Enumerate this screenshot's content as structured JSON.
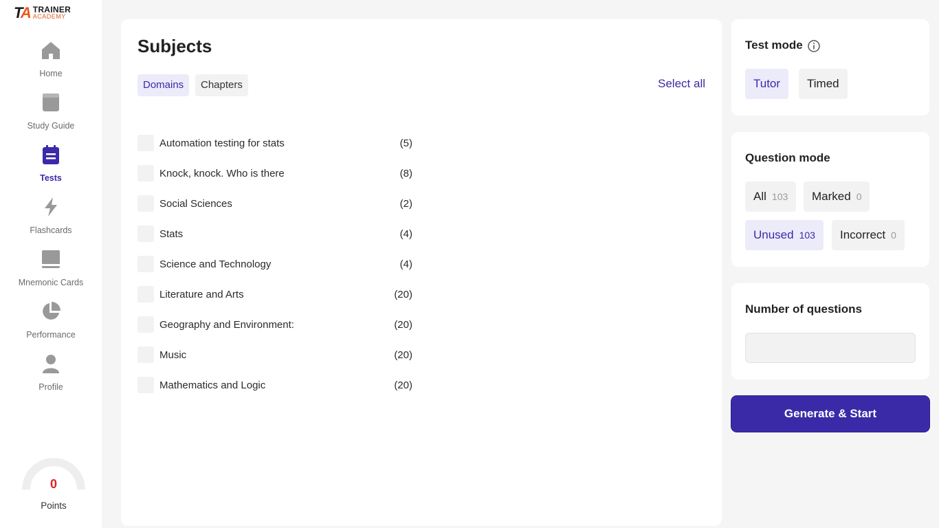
{
  "app": {
    "logo_mark": "TA",
    "logo_line1": "TRAINER",
    "logo_line2": "ACADEMY"
  },
  "sidebar": {
    "items": [
      {
        "label": "Home",
        "icon": "home-icon",
        "active": false
      },
      {
        "label": "Study Guide",
        "icon": "book-icon",
        "active": false
      },
      {
        "label": "Tests",
        "icon": "clipboard-icon",
        "active": true
      },
      {
        "label": "Flashcards",
        "icon": "lightning-icon",
        "active": false
      },
      {
        "label": "Mnemonic Cards",
        "icon": "card-icon",
        "active": false
      },
      {
        "label": "Performance",
        "icon": "pie-chart-icon",
        "active": false
      },
      {
        "label": "Profile",
        "icon": "user-icon",
        "active": false
      }
    ],
    "points": {
      "value": "0",
      "label": "Points"
    }
  },
  "subjects": {
    "title": "Subjects",
    "tabs": [
      {
        "label": "Domains",
        "selected": true
      },
      {
        "label": "Chapters",
        "selected": false
      }
    ],
    "select_all": "Select all",
    "items": [
      {
        "name": "Automation testing for stats",
        "count": "(5)"
      },
      {
        "name": "Knock, knock. Who is there",
        "count": "(8)"
      },
      {
        "name": "Social Sciences",
        "count": "(2)"
      },
      {
        "name": "Stats",
        "count": "(4)"
      },
      {
        "name": "Science and Technology",
        "count": "(4)"
      },
      {
        "name": "Literature and Arts",
        "count": "(20)"
      },
      {
        "name": "Geography and Environment:",
        "count": "(20)"
      },
      {
        "name": "Music",
        "count": "(20)"
      },
      {
        "name": "Mathematics and Logic",
        "count": "(20)"
      }
    ]
  },
  "test_mode": {
    "title": "Test mode",
    "options": [
      {
        "label": "Tutor",
        "selected": true
      },
      {
        "label": "Timed",
        "selected": false
      }
    ]
  },
  "question_mode": {
    "title": "Question mode",
    "options": [
      {
        "label": "All",
        "count": "103",
        "selected": false
      },
      {
        "label": "Marked",
        "count": "0",
        "selected": false
      },
      {
        "label": "Unused",
        "count": "103",
        "selected": true
      },
      {
        "label": "Incorrect",
        "count": "0",
        "selected": false
      }
    ]
  },
  "num_questions": {
    "title": "Number of questions",
    "value": "",
    "placeholder": ""
  },
  "actions": {
    "generate_label": "Generate & Start"
  },
  "colors": {
    "accent": "#3b2aa8",
    "accent_light": "#ecebfa",
    "points_red": "#e02020",
    "logo_orange": "#e85a1d"
  }
}
